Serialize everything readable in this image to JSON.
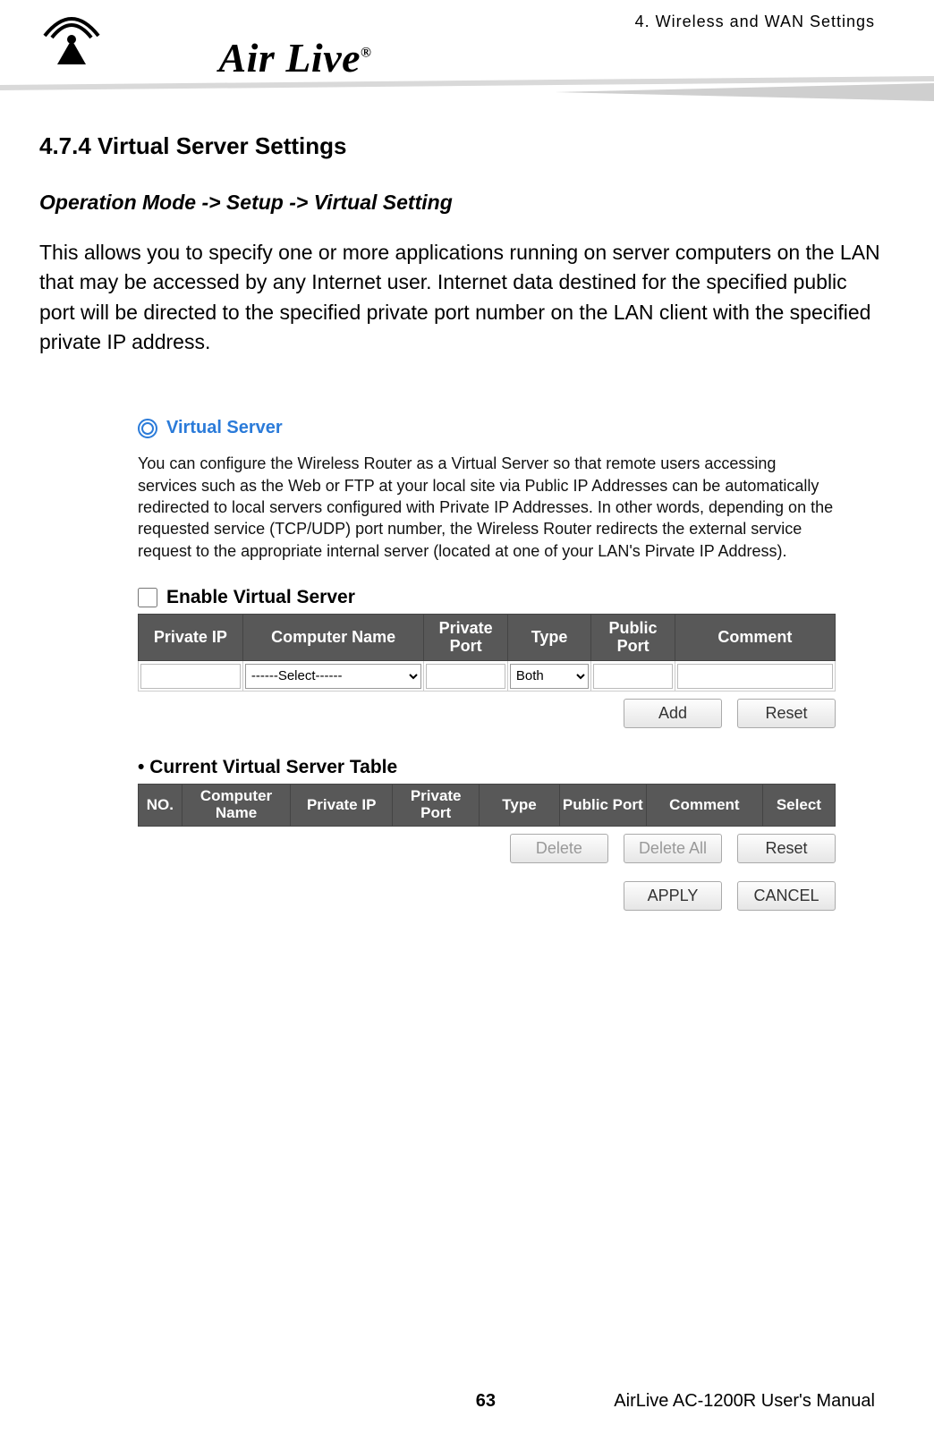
{
  "header": {
    "chapter_label": "4.  Wireless  and  WAN  Settings",
    "brand": "Air Live",
    "brand_reg": "®"
  },
  "section": {
    "number_title": "4.7.4 Virtual Server Settings",
    "breadcrumb": "Operation Mode -> Setup -> Virtual Setting",
    "intro": "This allows you to specify one or more applications running on server computers on the LAN that may be accessed by any Internet user. Internet data destined for the specified public port will be directed to the specified private port number on the LAN client with the specified private IP address."
  },
  "panel": {
    "title": "Virtual Server",
    "description": "You can configure the Wireless Router as a Virtual Server so that remote users accessing services such as the Web or FTP at your local site via Public IP Addresses can be automatically redirected to local servers configured with Private IP Addresses. In other words, depending on the requested service (TCP/UDP) port number, the Wireless Router redirects the external service request to the appropriate internal server (located at one of your LAN's Pirvate IP Address).",
    "enable_label": "Enable Virtual Server",
    "enable_checked": false,
    "input_headers": {
      "private_ip": "Private IP",
      "computer_name": "Computer Name",
      "private_port": "Private Port",
      "type": "Type",
      "public_port": "Public Port",
      "comment": "Comment"
    },
    "input_row": {
      "private_ip": "",
      "computer_name_selected": "------Select------",
      "private_port": "",
      "type_selected": "Both",
      "public_port": "",
      "comment": ""
    },
    "input_buttons": {
      "add": "Add",
      "reset": "Reset"
    },
    "current_table_label": "Current Virtual Server Table",
    "current_headers": {
      "no": "NO.",
      "computer_name": "Computer Name",
      "private_ip": "Private IP",
      "private_port": "Private Port",
      "type": "Type",
      "public_port": "Public Port",
      "comment": "Comment",
      "select": "Select"
    },
    "current_buttons": {
      "delete": "Delete",
      "delete_all": "Delete All",
      "reset": "Reset"
    },
    "final_buttons": {
      "apply": "APPLY",
      "cancel": "CANCEL"
    }
  },
  "footer": {
    "page_number": "63",
    "manual_title": "AirLive AC-1200R User's Manual"
  }
}
